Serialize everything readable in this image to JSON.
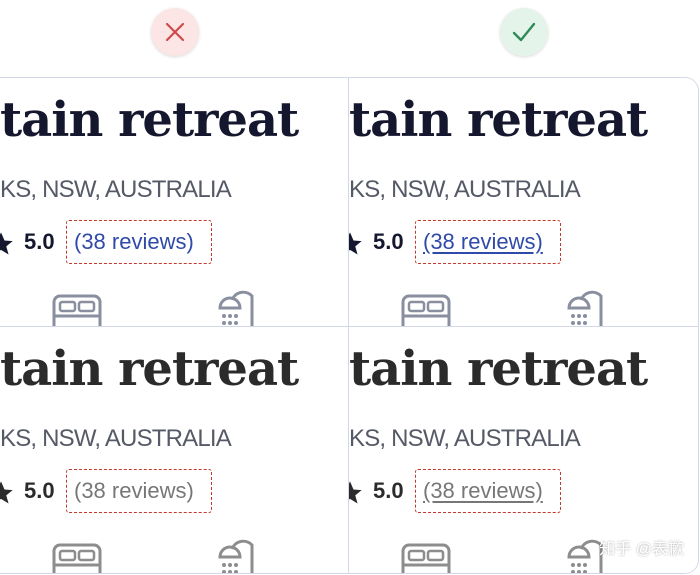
{
  "badges": {
    "incorrect_icon": "x-icon",
    "correct_icon": "check-icon"
  },
  "panels": [
    {
      "title": "tain retreat",
      "location": "KS, NSW, AUSTRALIA",
      "rating": "5.0",
      "reviews": "(38 reviews)"
    },
    {
      "title": "tain retreat",
      "location": "KS, NSW, AUSTRALIA",
      "rating": "5.0",
      "reviews": "(38 reviews)"
    },
    {
      "title": "tain retreat",
      "location": "KS, NSW, AUSTRALIA",
      "rating": "5.0",
      "reviews": "(38 reviews)"
    },
    {
      "title": "tain retreat",
      "location": "KS, NSW, AUSTRALIA",
      "rating": "5.0",
      "reviews": "(38 reviews)"
    }
  ],
  "watermark": "知乎 @表歉",
  "colors": {
    "incorrect": "#d04a4a",
    "correct": "#2e8b57",
    "link_blue": "#2f4aa8",
    "dashed_outline": "#c0392b"
  }
}
